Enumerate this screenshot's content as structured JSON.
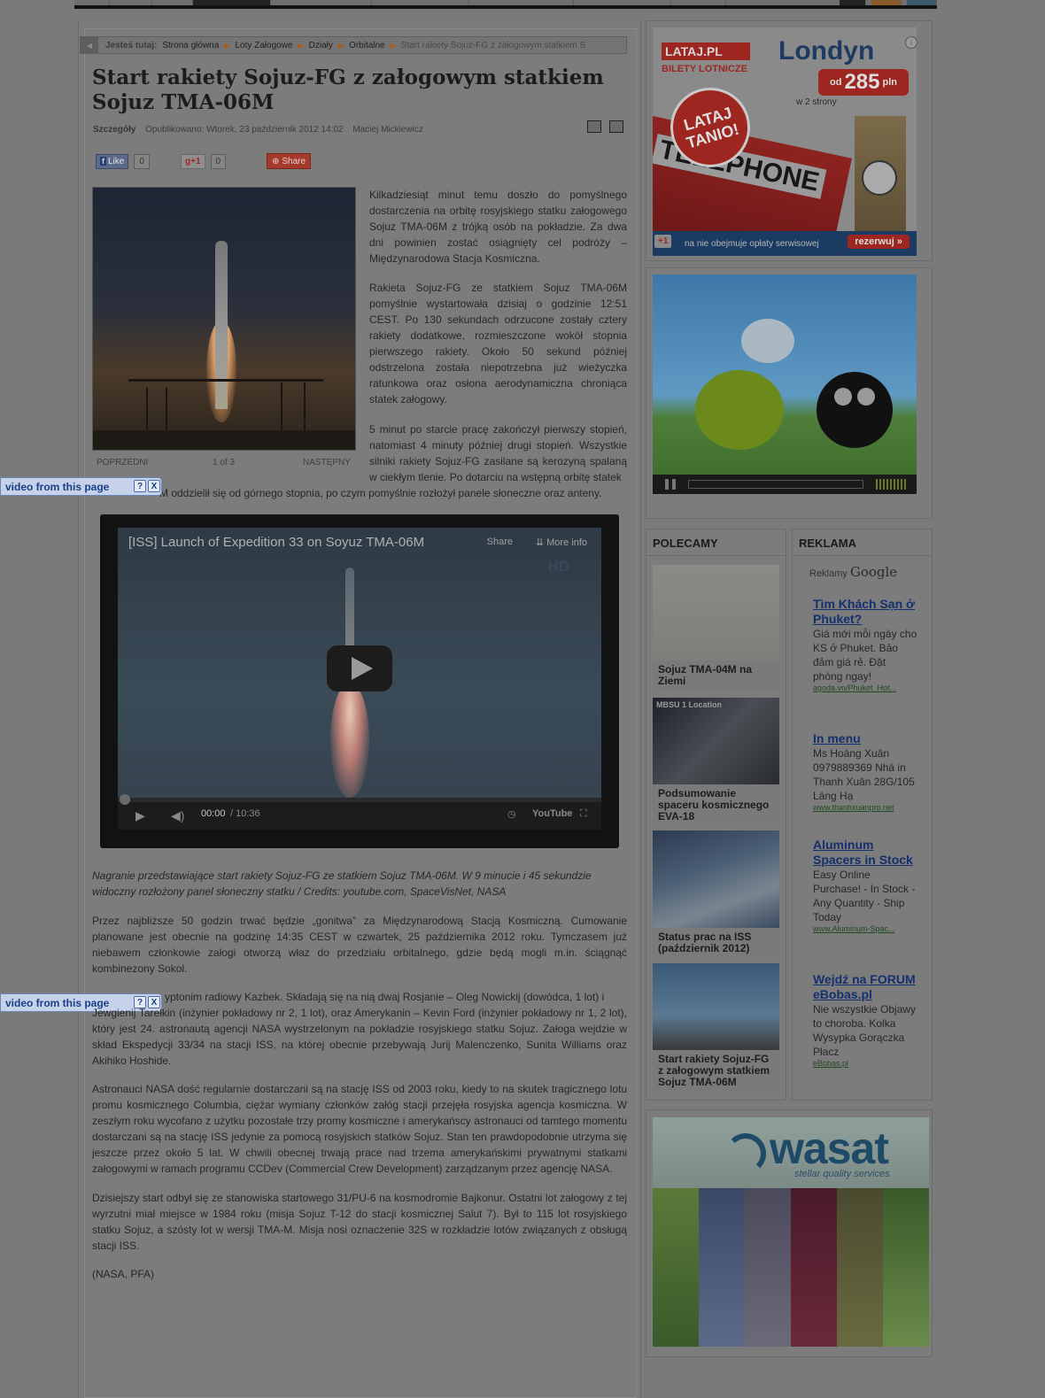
{
  "breadcrumb": {
    "label": "Jesteś tutaj:",
    "items": [
      "Strona główna",
      "Loty Załogowe",
      "Działy",
      "Orbitalne"
    ],
    "current": "Start rakiety Sojuz-FG z załogowym statkiem S"
  },
  "article": {
    "title": "Start rakiety Sojuz-FG z załogowym statkiem Sojuz TMA-06M",
    "meta_label": "Szczegóły",
    "published": "Opublikowano: Wtorek, 23 październik 2012 14:02",
    "author": "Maciej Mickiewicz",
    "social": {
      "like_label": "Like",
      "like_count": "0",
      "gplus_label": "+1",
      "gplus_count": "0",
      "share_label": "Share"
    },
    "gallery": {
      "prev": "POPRZEDNI",
      "counter": "1 of 3",
      "next": "NASTĘPNY"
    },
    "p1": "Kilkadziesiąt minut temu doszło do pomyślnego dostarczenia na orbitę rosyjskiego statku załogowego Sojuz TMA-06M z trójką osób na pokładzie. Za dwa dni powinien zostać osiągnięty cel podróży – Międzynarodowa Stacja Kosmiczna.",
    "p2": "Rakieta Sojuz-FG ze statkiem Sojuz TMA-06M pomyślnie wystartowała dzisiaj o godzinie 12:51 CEST. Po 130 sekundach odrzucone zostały cztery rakiety dodatkowe, rozmieszczone wokół stopnia pierwszego rakiety. Około 50 sekund później odstrzelona została niepotrzebna już wieżyczka ratunkowa oraz osłona aerodynamiczna chroniąca statek załogowy.",
    "p3": "5 minut po starcie pracę zakończył pierwszy stopień, natomiast 4 minuty później drugi stopień. Wszystkie silniki rakiety Sojuz-FG zasilane są kerozyną spalaną w ciekłym tlenie. Po dotarciu na wstępną orbitę statek",
    "p3b": "M oddzielił się od górnego stopnia, po czym pomyślnie rozłożył panele słoneczne oraz anteny.",
    "caption": "Nagranie przedstawiające start rakiety Sojuz-FG ze statkiem Sojuz TMA-06M. W 9 minucie i 45 sekundzie widoczny rozłożony panel słoneczny statku / Credits: youtube.com, SpaceVisNet, NASA",
    "p4": "Przez najbliższe 50 godzin trwać będzie „gonitwa” za Międzynarodową Stacją Kosmiczną. Cumowanie planowane jest obecnie na godzinę 14:35 CEST w czwartek, 25 października 2012 roku. Tymczasem już niebawem członkowie załogi otworzą właz do przedziału orbitalnego, gdzie będą mogli m.in. ściągnąć kombinezony Sokol.",
    "p5a": "yptonim radiowy Kazbek. Składają się na nią dwaj Rosjanie – Oleg Nowickij (dowódca, 1 lot) i",
    "p5b": "Jewgienij Tarełkin (inżynier pokładowy nr 2, 1 lot), oraz Amerykanin – Kevin Ford (inżynier pokładowy nr 1, 2 lot), który jest 24. astronautą agencji NASA wystrzelonym na pokładzie rosyjskiego statku Sojuz. Załoga wejdzie w skład Ekspedycji 33/34 na stacji ISS, na której obecnie przebywają Jurij Malenczenko, Sunita Williams oraz Akihiko Hoshide.",
    "p6": "Astronauci NASA dość regularnie dostarczani są na stację ISS od 2003 roku, kiedy to na skutek tragicznego lotu promu kosmicznego Columbia, ciężar wymiany członków załóg stacji przejęła rosyjska agencja kosmiczna. W zeszłym roku wycofano z użytku pozostałe trzy promy kosmiczne i amerykańscy astronauci od tamtego momentu dostarczani są na stację ISS jedynie za pomocą rosyjskich statków Sojuz. Stan ten prawdopodobnie utrzyma się jeszcze przez około 5 lat. W chwili obecnej trwają prace nad trzema amerykańskimi prywatnymi statkami załogowymi w ramach programu CCDev (Commercial Crew Development) zarządzanym przez agencję NASA.",
    "p7": "Dzisiejszy start odbył się ze stanowiska startowego 31/PU-6 na kosmodromie Bajkonur. Ostatni lot załogowy z tej wyrzutni miał miejsce w 1984 roku (misja Sojuz T-12 do stacji kosmicznej Salut 7). Był to 115 lot rosyjskiego statku Sojuz, a szósty lot w wersji TMA-M. Misja nosi oznaczenie 32S w rozkładzie lotów związanych z obsługą stacji ISS.",
    "source": "(NASA, PFA)"
  },
  "notice": {
    "text": "video from this page",
    "help": "?",
    "close": "X"
  },
  "video": {
    "title": "[ISS] Launch of Expedition 33 on Soyuz TMA-06M",
    "share": "Share",
    "more": "More info",
    "hd": "HD",
    "time_current": "00:00",
    "time_total": "/ 10:36",
    "brand": "YouTube"
  },
  "ads": {
    "lataj": {
      "logo": "LATAJ.PL",
      "bilety": "BILETY LOTNICZE",
      "city": "Londyn",
      "price_prefix": "od",
      "price": "285",
      "price_unit": "pln",
      "strony": "w 2 strony",
      "badge": "LATAJ TANIO!",
      "telephone": "TELEPHONE",
      "footer": "na nie obejmuje opłaty serwisowej",
      "cta": "rezerwuj »",
      "gplus": "+1"
    },
    "wasat": {
      "logo": "wasat",
      "tagline": "stellar quality services"
    }
  },
  "polecamy": {
    "heading": "POLECAMY",
    "items": [
      {
        "label": "Sojuz TMA-04M na Ziemi"
      },
      {
        "label": "Podsumowanie spaceru kosmicznego EVA-18",
        "thumb_text": "MBSU 1 Location"
      },
      {
        "label": "Status prac na ISS (październik 2012)"
      },
      {
        "label": "Start rakiety Sojuz-FG z załogowym statkiem Sojuz TMA-06M"
      }
    ]
  },
  "reklama": {
    "heading": "REKLAMA",
    "google_label": "Reklamy",
    "google_brand": "Google",
    "items": [
      {
        "title": "Tìm Khách Sạn ở Phuket?",
        "desc": "Giá mới mỗi ngày cho KS ở Phuket. Bảo đảm giá rẻ. Đặt phòng ngay!",
        "url": "agoda.vn/Phuket_Hot..."
      },
      {
        "title": "In menu",
        "desc": "Ms Hoàng Xuân 0979889369 Nhà in Thanh Xuân 28G/105 Láng Hạ",
        "url": "www.thanhxuanpro.net"
      },
      {
        "title": "Aluminum Spacers in Stock",
        "desc": "Easy Online Purchase! - In Stock - Any Quantity - Ship Today",
        "url": "www.Aluminum-Spac..."
      },
      {
        "title": "Wejdź na FORUM eBobas.pl",
        "desc": "Nie wszystkie Objawy to choroba. Kolka Wysypka Gorączka Płacz",
        "url": "eBobas.pl"
      }
    ]
  }
}
